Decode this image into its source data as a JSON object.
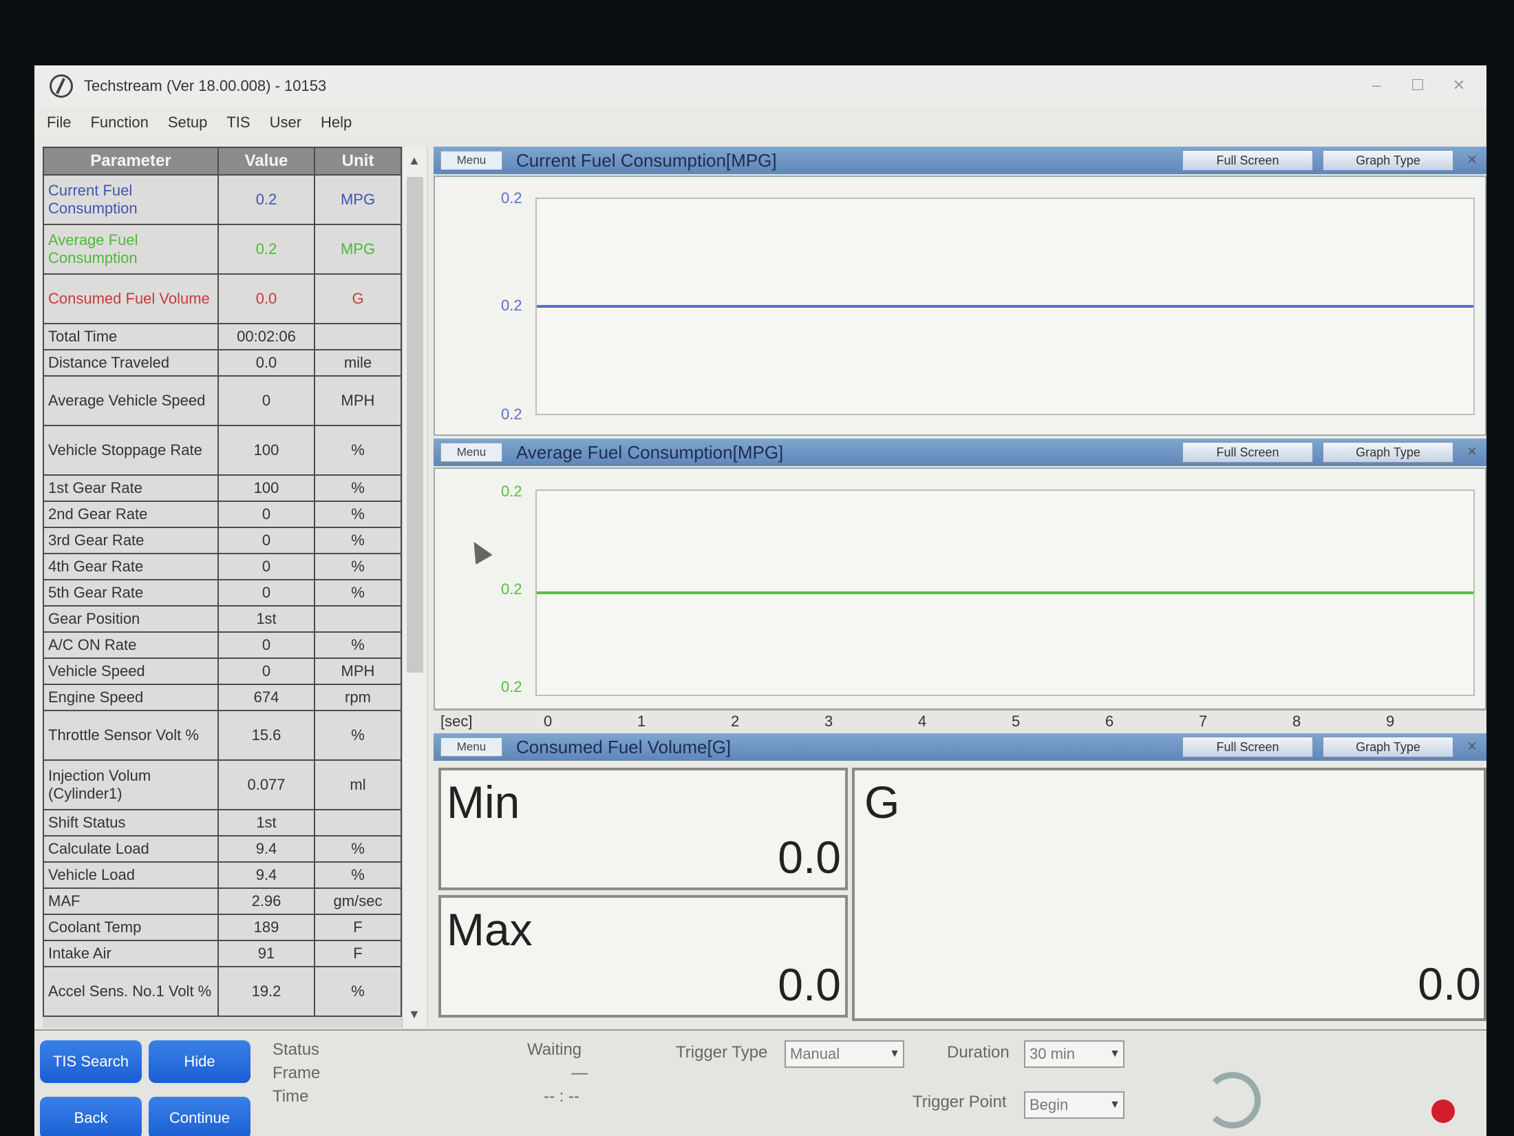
{
  "window": {
    "title": "Techstream (Ver 18.00.008) - 10153",
    "controls": [
      "–",
      "☐",
      "✕"
    ]
  },
  "menubar": [
    "File",
    "Function",
    "Setup",
    "TIS",
    "User",
    "Help"
  ],
  "param_table": {
    "headers": [
      "Parameter",
      "Value",
      "Unit"
    ],
    "rows": [
      {
        "name": "Current Fuel Consumption",
        "value": "0.2",
        "unit": "MPG",
        "color": "blue",
        "tall": true
      },
      {
        "name": "Average Fuel Consumption",
        "value": "0.2",
        "unit": "MPG",
        "color": "green",
        "tall": true
      },
      {
        "name": "Consumed Fuel Volume",
        "value": "0.0",
        "unit": "G",
        "color": "red",
        "tall": true
      },
      {
        "name": "Total Time",
        "value": "00:02:06",
        "unit": ""
      },
      {
        "name": "Distance Traveled",
        "value": "0.0",
        "unit": "mile"
      },
      {
        "name": "Average Vehicle Speed",
        "value": "0",
        "unit": "MPH",
        "tall": true
      },
      {
        "name": "Vehicle Stoppage Rate",
        "value": "100",
        "unit": "%",
        "tall": true
      },
      {
        "name": "1st Gear Rate",
        "value": "100",
        "unit": "%"
      },
      {
        "name": "2nd Gear Rate",
        "value": "0",
        "unit": "%"
      },
      {
        "name": "3rd Gear Rate",
        "value": "0",
        "unit": "%"
      },
      {
        "name": "4th Gear Rate",
        "value": "0",
        "unit": "%"
      },
      {
        "name": "5th Gear Rate",
        "value": "0",
        "unit": "%"
      },
      {
        "name": "Gear Position",
        "value": "1st",
        "unit": ""
      },
      {
        "name": "A/C ON Rate",
        "value": "0",
        "unit": "%"
      },
      {
        "name": "Vehicle Speed",
        "value": "0",
        "unit": "MPH"
      },
      {
        "name": "Engine Speed",
        "value": "674",
        "unit": "rpm"
      },
      {
        "name": "Throttle Sensor Volt %",
        "value": "15.6",
        "unit": "%",
        "tall": true
      },
      {
        "name": "Injection Volum (Cylinder1)",
        "value": "0.077",
        "unit": "ml",
        "tall": true
      },
      {
        "name": "Shift Status",
        "value": "1st",
        "unit": ""
      },
      {
        "name": "Calculate Load",
        "value": "9.4",
        "unit": "%"
      },
      {
        "name": "Vehicle Load",
        "value": "9.4",
        "unit": "%"
      },
      {
        "name": "MAF",
        "value": "2.96",
        "unit": "gm/sec"
      },
      {
        "name": "Coolant Temp",
        "value": "189",
        "unit": "F"
      },
      {
        "name": "Intake Air",
        "value": "91",
        "unit": "F"
      },
      {
        "name": "Accel Sens. No.1 Volt %",
        "value": "19.2",
        "unit": "%",
        "tall": true
      }
    ]
  },
  "graphs": {
    "current": {
      "menu_label": "Menu",
      "title": "Current Fuel Consumption[MPG]",
      "full_screen_label": "Full Screen",
      "graph_type_label": "Graph Type",
      "y_labels": [
        "0.2",
        "0.2",
        "0.2"
      ],
      "line_color": "#5b6fc9",
      "value_level": 0.5
    },
    "average": {
      "menu_label": "Menu",
      "title": "Average Fuel Consumption[MPG]",
      "full_screen_label": "Full Screen",
      "graph_type_label": "Graph Type",
      "y_labels": [
        "0.2",
        "0.2",
        "0.2"
      ],
      "line_color": "#52c23a",
      "value_level": 0.5
    },
    "time_axis": {
      "label": "[sec]",
      "ticks": [
        "0",
        "1",
        "2",
        "3",
        "4",
        "5",
        "6",
        "7",
        "8",
        "9"
      ]
    },
    "consumed": {
      "menu_label": "Menu",
      "title": "Consumed Fuel Volume[G]",
      "full_screen_label": "Full Screen",
      "graph_type_label": "Graph Type",
      "min_label": "Min",
      "min_value": "0.0",
      "max_label": "Max",
      "max_value": "0.0",
      "unit_label": "G",
      "current_value": "0.0"
    }
  },
  "statusbar": {
    "buttons": {
      "tis_search": "TIS Search",
      "hide": "Hide",
      "back": "Back",
      "continue": "Continue"
    },
    "status_label": "Status",
    "frame_label": "Frame",
    "time_label": "Time",
    "waiting_text": "Waiting",
    "frame_value": "—",
    "time_value": "-- : --",
    "trigger_type_label": "Trigger Type",
    "trigger_type_value": "Manual",
    "duration_label": "Duration",
    "duration_value": "30 min",
    "trigger_point_label": "Trigger Point",
    "trigger_point_value": "Begin"
  }
}
